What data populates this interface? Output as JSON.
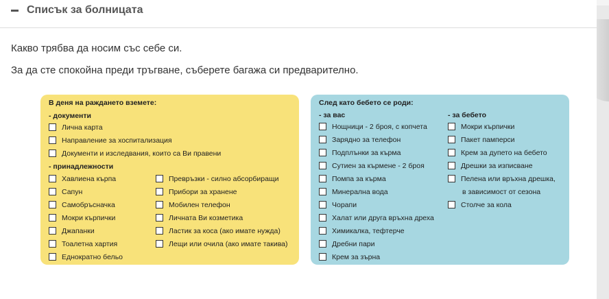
{
  "header": {
    "title": "Списък за болницата"
  },
  "intro": {
    "line1": "Какво трябва да носим със себе си.",
    "line2": "За да сте спокойна преди тръгване, съберете багажа си предварително."
  },
  "birth_day": {
    "title": "В деня на раждането вземете:",
    "documents": {
      "heading": "- документи",
      "items": [
        "Лична карта",
        "Направление за хоспитализация",
        "Документи и изследвания, които са Ви правени"
      ]
    },
    "belongings": {
      "heading": "- принадлежности",
      "col1": [
        "Хавлиена кърпа",
        "Сапун",
        "Самобръсначка",
        "Мокри кърпички",
        "Джапанки",
        "Тоалетна хартия",
        "Еднократно бельо"
      ],
      "col2": [
        "Превръзки - силно абсорбиращи",
        "Прибори за хранене",
        "Мобилен телефон",
        "Личната Ви козметика",
        "Ластик за коса (ако имате нужда)",
        "Лещи или очила (ако имате такива)"
      ]
    }
  },
  "after_birth": {
    "title": "След като бебето се роди:",
    "for_you": {
      "heading": "- за вас",
      "items": [
        "Нощници - 2 броя, с копчета",
        "Зарядно за телефон",
        "Подплънки за кърма",
        "Сутиен за кърмене - 2 броя",
        "Помпа за кърма",
        "Минерална вода",
        "Чорапи",
        "Халат или друга връхна дреха",
        "Химикалка, тефтерче",
        "Дребни пари",
        "Крем за зърна"
      ]
    },
    "for_baby": {
      "heading": "- за бебето",
      "items": [
        "Мокри кърпички",
        "Пакет памперси",
        "Крем за дупето на бебето",
        "Дрешки за изписване",
        "Пелена или връхна дрешка,"
      ],
      "continuation": "в зависимост от сезона",
      "last_item": "Столче за кола"
    }
  }
}
